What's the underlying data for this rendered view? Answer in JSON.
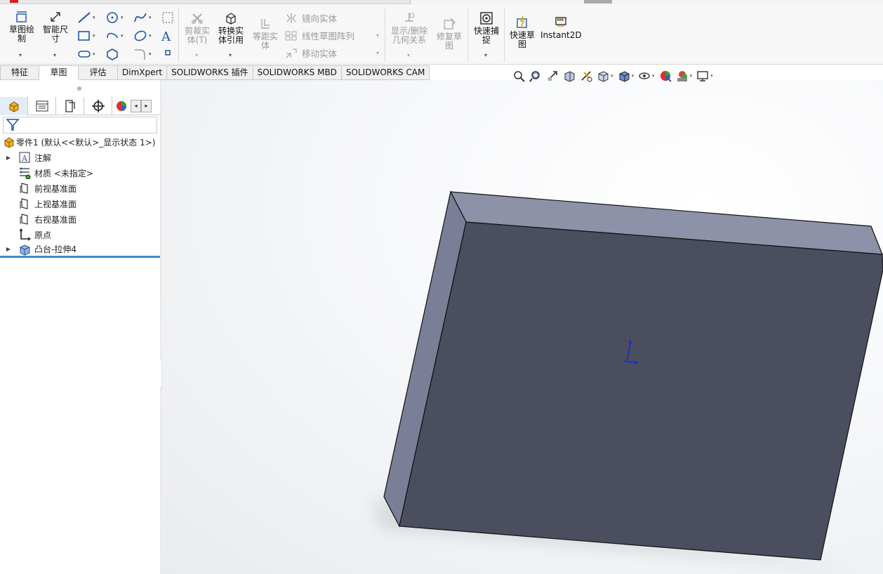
{
  "ribbon": {
    "sketch_draw": "草图绘\n制",
    "smart_dim": "智能尺\n寸",
    "trim": "剪裁实\n体(T)",
    "convert": "转换实\n体引用",
    "offset": "等距实\n体",
    "mirror": "镜向实体",
    "linear_pattern": "线性草图阵列",
    "move": "移动实体",
    "show_relations": "显示/删除\n几何关系",
    "repair": "修复草\n图",
    "quick_snap": "快速捕\n捉",
    "rapid_sketch": "快速草\n图",
    "instant2d": "Instant2D"
  },
  "tabs": [
    "特征",
    "草图",
    "评估",
    "DimXpert",
    "SOLIDWORKS 插件",
    "SOLIDWORKS MBD",
    "SOLIDWORKS CAM"
  ],
  "active_tab": "草图",
  "tree": {
    "root": "零件1  (默认<<默认>_显示状态 1>)",
    "items": [
      {
        "label": "注解",
        "icon": "annotation-icon",
        "expandable": true
      },
      {
        "label": "材质 <未指定>",
        "icon": "material-icon",
        "expandable": false
      },
      {
        "label": "前视基准面",
        "icon": "plane-icon",
        "expandable": false
      },
      {
        "label": "上视基准面",
        "icon": "plane-icon",
        "expandable": false
      },
      {
        "label": "右视基准面",
        "icon": "plane-icon",
        "expandable": false
      },
      {
        "label": "原点",
        "icon": "origin-icon",
        "expandable": false
      },
      {
        "label": "凸台-拉伸4",
        "icon": "extrude-icon",
        "expandable": true
      }
    ]
  },
  "colors": {
    "face_front": "#4a4e5e",
    "face_top": "#8c90a6",
    "face_side": "#6f7389",
    "selection": "#3c8dc8"
  }
}
